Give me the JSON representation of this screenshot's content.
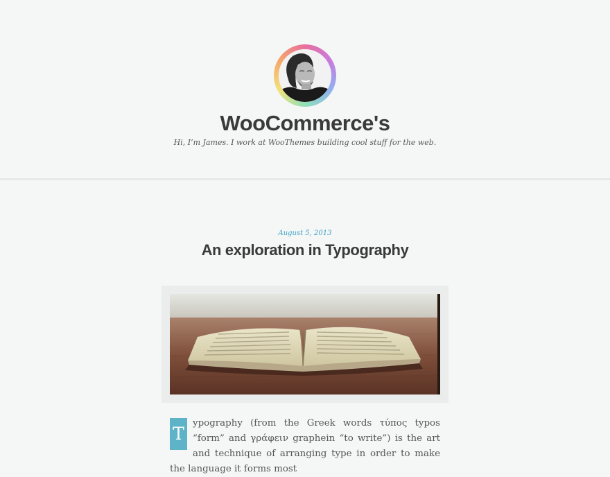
{
  "site": {
    "title": "WooCommerce's",
    "description": "Hi, I’m James. I work at WooThemes building cool stuff for the web.",
    "avatar_alt": "avatar"
  },
  "post": {
    "date": "August 5, 2013",
    "title": "An exploration in Typography",
    "dropcap": "T",
    "body": "ypography (from the Greek words τύπος typos “form” and γράφειν graphein “to write”) is the art and technique of arranging type in order to make the language it forms most"
  },
  "colors": {
    "background": "#f5f6f6",
    "accent": "#41a2c6",
    "dropcap_bg": "#5fb3c8",
    "title": "#3a3a3a"
  }
}
